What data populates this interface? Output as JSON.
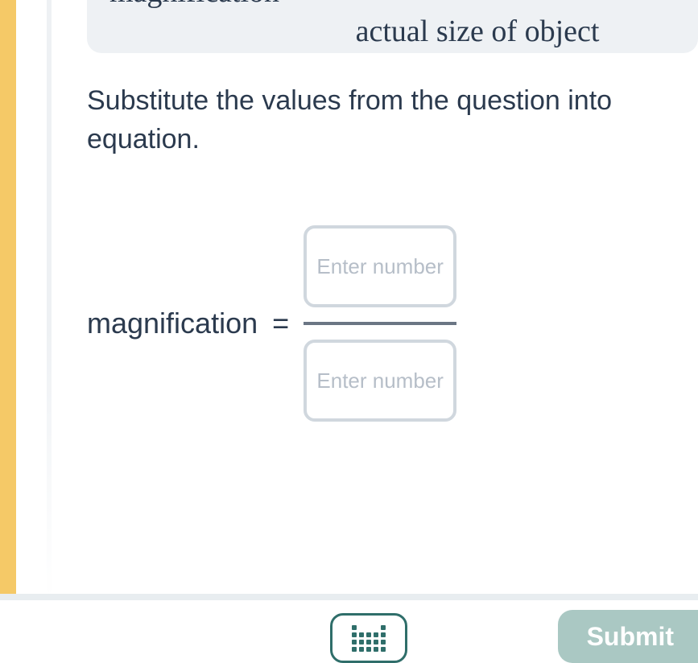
{
  "hint": {
    "lhs": "magnification",
    "rhs_bottom": "actual size of object"
  },
  "instruction": "Substitute the values from the question into equation.",
  "equation": {
    "lhs": "magnification",
    "eq": "=",
    "numerator_placeholder": "Enter number",
    "denominator_placeholder": "Enter number"
  },
  "footer": {
    "submit_label": "Submit"
  }
}
